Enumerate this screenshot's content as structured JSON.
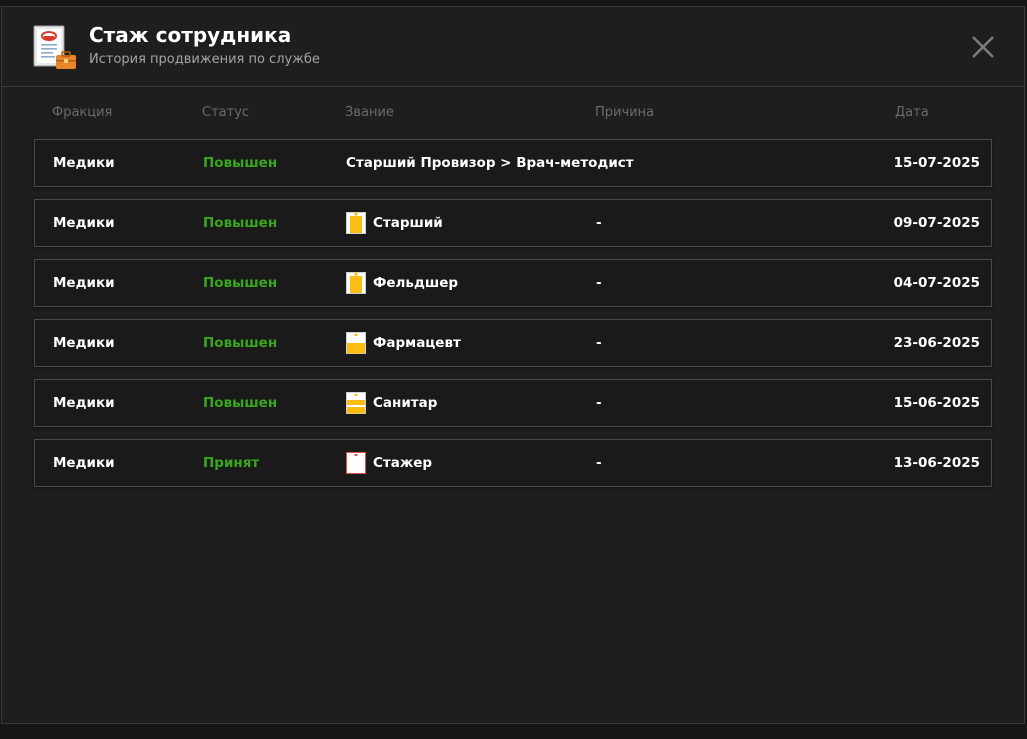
{
  "header": {
    "title": "Стаж сотрудника",
    "subtitle": "История продвижения по службе",
    "app_icon": "document-briefcase-icon",
    "close_icon": "close-icon"
  },
  "columns": {
    "faction": "Фракция",
    "status": "Статус",
    "rank": "Звание",
    "reason": "Причина",
    "date": "Дата"
  },
  "colors": {
    "status_green": "#3aa61f",
    "rank_yellow": "#fbbd12",
    "background": "#1e1e1e"
  },
  "rows": [
    {
      "faction": "Медики",
      "status": "Повышен",
      "rank": "Старший Провизор > Врач-методист",
      "reason": "",
      "date": "15-07-2025"
    },
    {
      "faction": "Медики",
      "status": "Повышен",
      "rank": "Старший",
      "reason": "-",
      "date": "09-07-2025",
      "icon": "rank-badge-full-icon"
    },
    {
      "faction": "Медики",
      "status": "Повышен",
      "rank": "Фельдшер",
      "reason": "-",
      "date": "04-07-2025",
      "icon": "rank-badge-full-icon"
    },
    {
      "faction": "Медики",
      "status": "Повышен",
      "rank": "Фармацевт",
      "reason": "-",
      "date": "23-06-2025",
      "icon": "rank-badge-half-icon"
    },
    {
      "faction": "Медики",
      "status": "Повышен",
      "rank": "Санитар",
      "reason": "-",
      "date": "15-06-2025",
      "icon": "rank-badge-stripes-icon"
    },
    {
      "faction": "Медики",
      "status": "Принят",
      "rank": "Стажер",
      "reason": "-",
      "date": "13-06-2025",
      "icon": "rank-badge-empty-icon"
    }
  ]
}
